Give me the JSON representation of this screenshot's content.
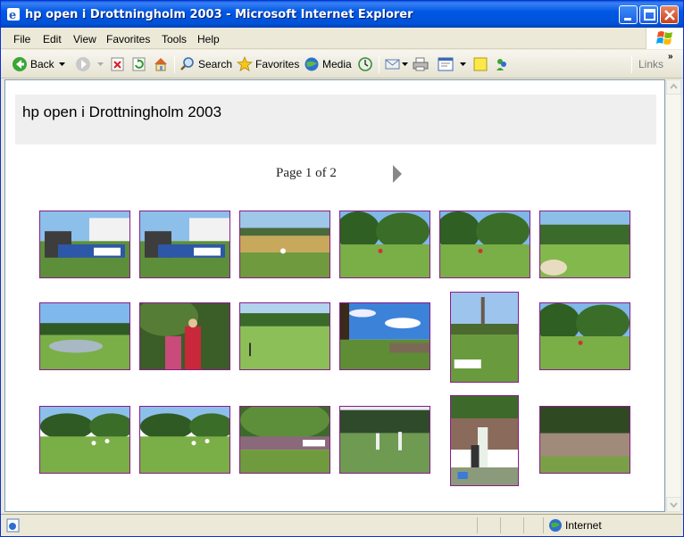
{
  "window": {
    "title": "hp open i Drottningholm 2003 - Microsoft Internet Explorer"
  },
  "menu": {
    "items": [
      "File",
      "Edit",
      "View",
      "Favorites",
      "Tools",
      "Help"
    ]
  },
  "toolbar": {
    "back_label": "Back",
    "search_label": "Search",
    "favorites_label": "Favorites",
    "media_label": "Media",
    "links_label": "Links"
  },
  "page": {
    "title": "hp open i Drottningholm 2003",
    "pager_text": "Page 1 of 2"
  },
  "thumbnails": [
    {
      "name": "photo-1",
      "scene": "crowd-tent",
      "orientation": "landscape"
    },
    {
      "name": "photo-2",
      "scene": "crowd-tent",
      "orientation": "landscape"
    },
    {
      "name": "photo-3",
      "scene": "field-players",
      "orientation": "landscape"
    },
    {
      "name": "photo-4",
      "scene": "fairway-trees",
      "orientation": "landscape"
    },
    {
      "name": "photo-5",
      "scene": "fairway-trees",
      "orientation": "landscape"
    },
    {
      "name": "photo-6",
      "scene": "fairway-bunker",
      "orientation": "landscape"
    },
    {
      "name": "photo-7",
      "scene": "pond",
      "orientation": "landscape"
    },
    {
      "name": "photo-8",
      "scene": "golfer-portrait",
      "orientation": "landscape"
    },
    {
      "name": "photo-9",
      "scene": "green-hill",
      "orientation": "landscape"
    },
    {
      "name": "photo-10",
      "scene": "sky-spectators",
      "orientation": "landscape"
    },
    {
      "name": "photo-11",
      "scene": "tower-field",
      "orientation": "portrait"
    },
    {
      "name": "photo-12",
      "scene": "fairway-trees",
      "orientation": "landscape"
    },
    {
      "name": "photo-13",
      "scene": "fairway-people",
      "orientation": "landscape"
    },
    {
      "name": "photo-14",
      "scene": "fairway-people",
      "orientation": "landscape"
    },
    {
      "name": "photo-15",
      "scene": "crowd-green",
      "orientation": "landscape"
    },
    {
      "name": "photo-16",
      "scene": "players-green",
      "orientation": "landscape"
    },
    {
      "name": "photo-17",
      "scene": "golfer-crowd",
      "orientation": "portrait"
    },
    {
      "name": "photo-18",
      "scene": "crowd-dense",
      "orientation": "landscape"
    }
  ],
  "status": {
    "zone_label": "Internet"
  },
  "colors": {
    "titlebar": "#0058e6",
    "thumb_border": "#8b1a8b",
    "header_bg": "#efefef"
  }
}
